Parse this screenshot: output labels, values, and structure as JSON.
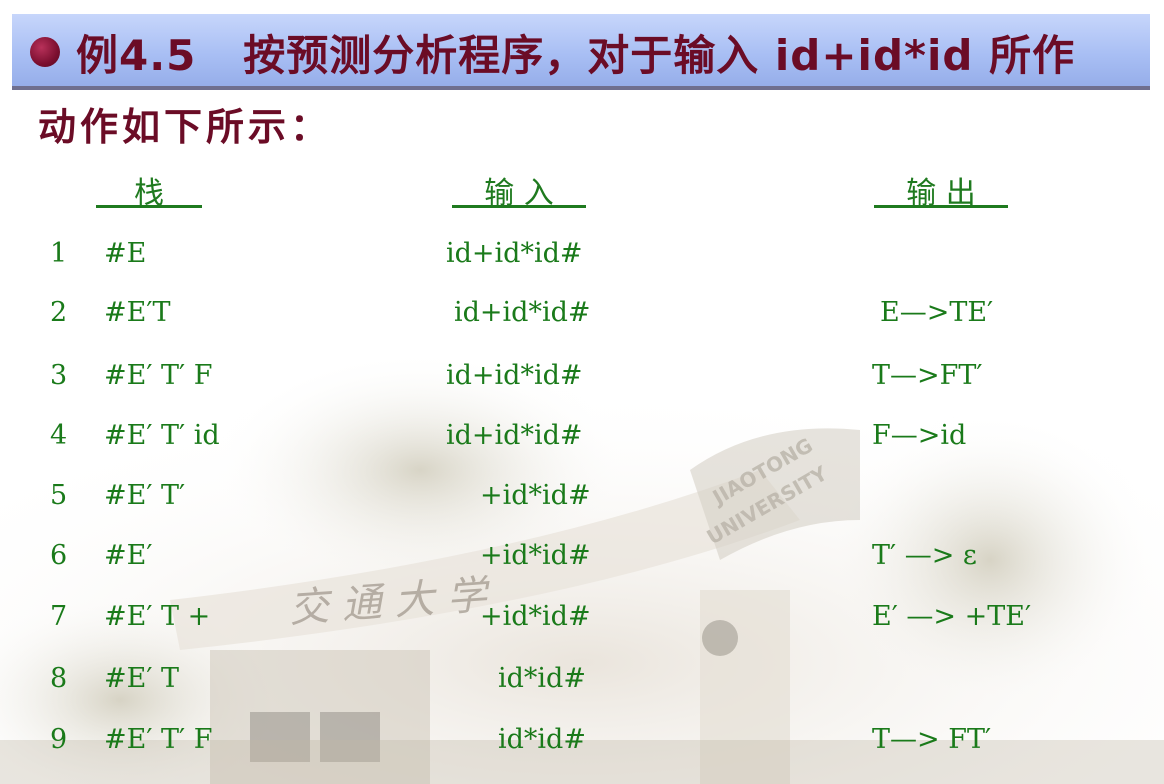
{
  "title": {
    "prefix": "例4.5",
    "line1": "按预测分析程序，对于输入 id+id*id 所作",
    "line2": "动作如下所示："
  },
  "headers": {
    "stack": "栈",
    "input": "输 入",
    "output": "输 出"
  },
  "rows": [
    {
      "num": "1",
      "stack": "#E",
      "input": "id+id*id#",
      "output": ""
    },
    {
      "num": "2",
      "stack": "#E′T",
      "input": "id+id*id#",
      "output": "E—>TE′"
    },
    {
      "num": "3",
      "stack": "#E′ T′ F",
      "input": "id+id*id#",
      "output": "T—>FT′"
    },
    {
      "num": "4",
      "stack": "#E′ T′ id",
      "input": "id+id*id#",
      "output": "F—>id"
    },
    {
      "num": "5",
      "stack": "#E′ T′",
      "input": "+id*id#",
      "output": ""
    },
    {
      "num": "6",
      "stack": "#E′",
      "input": "+id*id#",
      "output": "T′ —> ε"
    },
    {
      "num": "7",
      "stack": "#E′ T +",
      "input": "+id*id#",
      "output": "E′ —> +TE′"
    },
    {
      "num": "8",
      "stack": "#E′ T",
      "input": "id*id#",
      "output": ""
    },
    {
      "num": "9",
      "stack": "#E′ T′ F",
      "input": "id*id#",
      "output": "T—> FT′"
    }
  ],
  "background": {
    "gate_sign": "交 通 大 学",
    "arch_text_1": "JIAOTONG",
    "arch_text_2": "UNIVERSITY"
  },
  "colors": {
    "title_text": "#6b0c26",
    "table_text": "#1a7a1a",
    "title_bar": "#a9bff4"
  }
}
